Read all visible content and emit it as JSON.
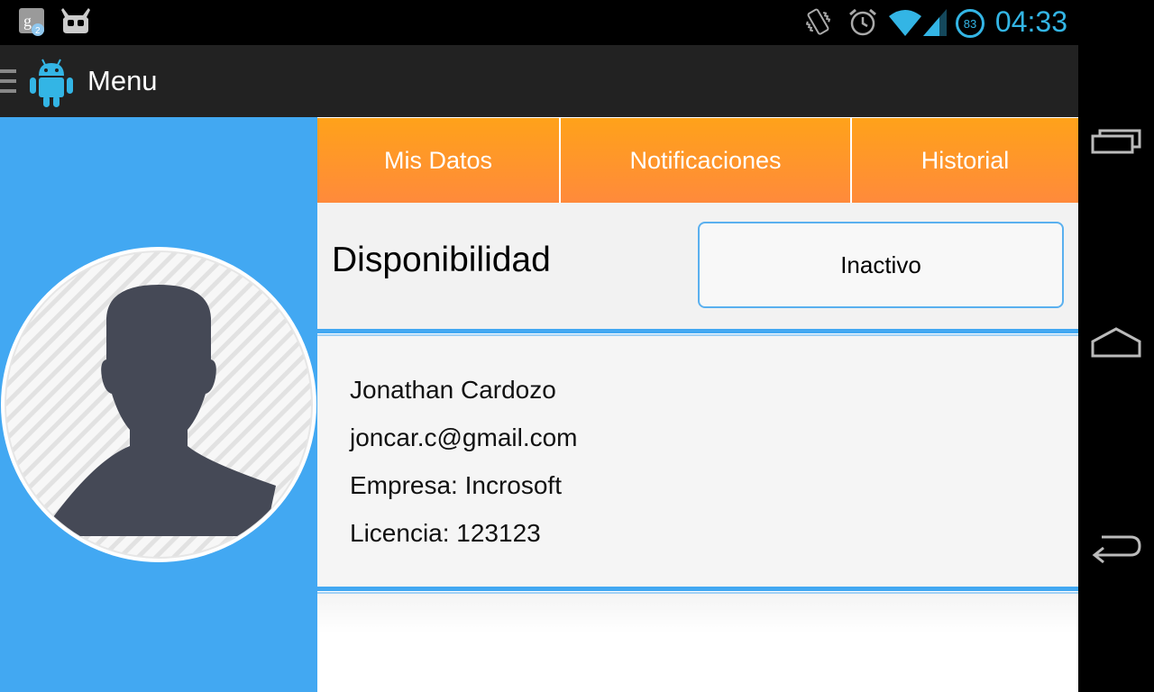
{
  "status_bar": {
    "time": "04:33",
    "battery_level": "83",
    "icons": [
      "google-search-icon",
      "cyanogen-mascot-icon",
      "vibrate-icon",
      "alarm-icon",
      "wifi-icon",
      "signal-icon",
      "battery-icon"
    ]
  },
  "action_bar": {
    "title": "Menu",
    "icons": [
      "hamburger-menu-icon",
      "android-logo-icon"
    ]
  },
  "tabs": [
    {
      "label": "Mis Datos"
    },
    {
      "label": "Notificaciones"
    },
    {
      "label": "Historial"
    }
  ],
  "availability": {
    "label": "Disponibilidad",
    "status": "Inactivo"
  },
  "profile": {
    "name": "Jonathan Cardozo",
    "email": "joncar.c@gmail.com",
    "company": "Empresa: Incrosoft",
    "license": "Licencia: 123123"
  },
  "nav_bar": {
    "icons": [
      "recent-apps-icon",
      "home-icon",
      "back-icon"
    ]
  },
  "colors": {
    "accent_blue": "#42a8f2",
    "tab_orange_top": "#ffa21a",
    "tab_orange_bottom": "#ff8a3b",
    "status_blue": "#33b5e5",
    "action_bar": "#222222"
  }
}
